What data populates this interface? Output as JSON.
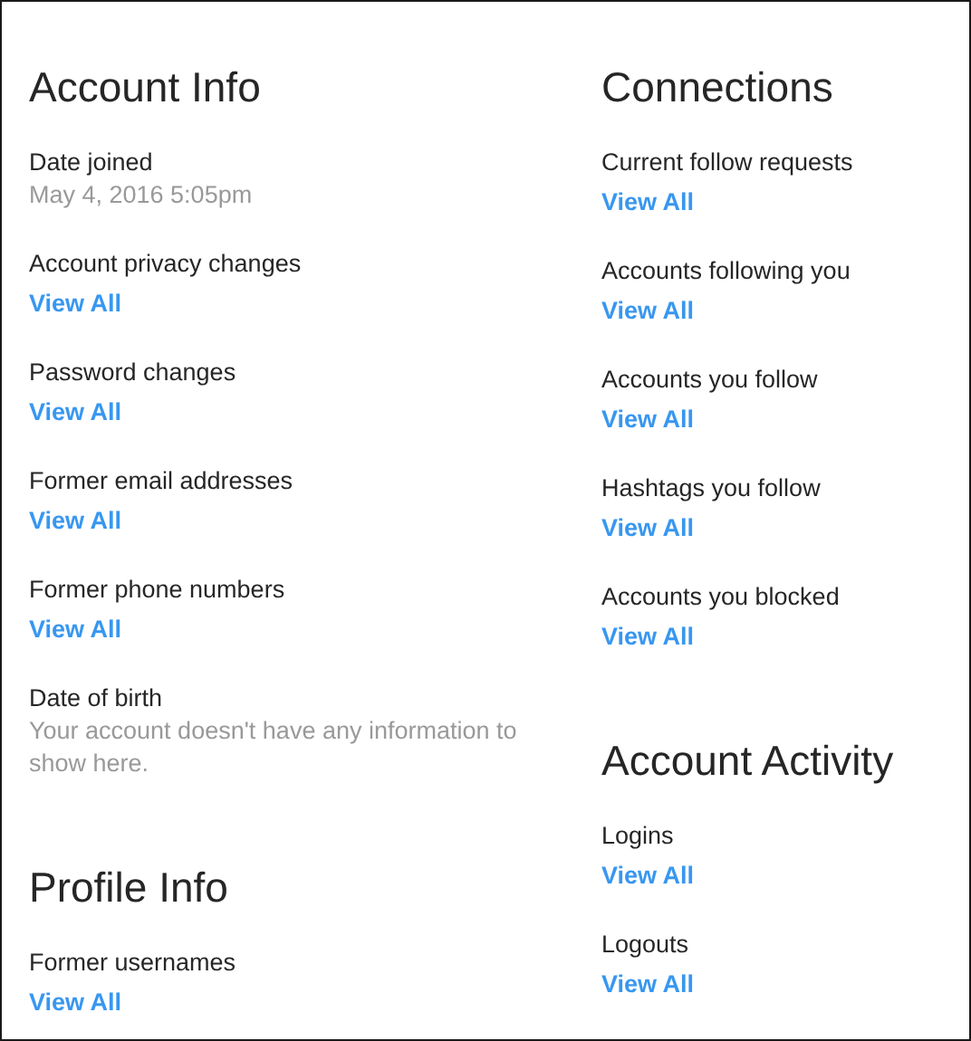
{
  "columns": [
    {
      "sections": [
        {
          "title": "Account Info",
          "items": [
            {
              "kind": "text",
              "label": "Date joined",
              "value": "May 4, 2016 5:05pm"
            },
            {
              "kind": "link",
              "label": "Account privacy changes",
              "link": "View All"
            },
            {
              "kind": "link",
              "label": "Password changes",
              "link": "View All"
            },
            {
              "kind": "link",
              "label": "Former email addresses",
              "link": "View All"
            },
            {
              "kind": "link",
              "label": "Former phone numbers",
              "link": "View All"
            },
            {
              "kind": "text",
              "label": "Date of birth",
              "value": "Your account doesn't have any information to show here."
            }
          ]
        },
        {
          "title": "Profile Info",
          "items": [
            {
              "kind": "link",
              "label": "Former usernames",
              "link": "View All"
            }
          ]
        }
      ]
    },
    {
      "sections": [
        {
          "title": "Connections",
          "items": [
            {
              "kind": "link",
              "label": "Current follow requests",
              "link": "View All"
            },
            {
              "kind": "link",
              "label": "Accounts following you",
              "link": "View All"
            },
            {
              "kind": "link",
              "label": "Accounts you follow",
              "link": "View All"
            },
            {
              "kind": "link",
              "label": "Hashtags you follow",
              "link": "View All"
            },
            {
              "kind": "link",
              "label": "Accounts you blocked",
              "link": "View All"
            }
          ]
        },
        {
          "title": "Account Activity",
          "items": [
            {
              "kind": "link",
              "label": "Logins",
              "link": "View All"
            },
            {
              "kind": "link",
              "label": "Logouts",
              "link": "View All"
            }
          ]
        }
      ]
    }
  ]
}
